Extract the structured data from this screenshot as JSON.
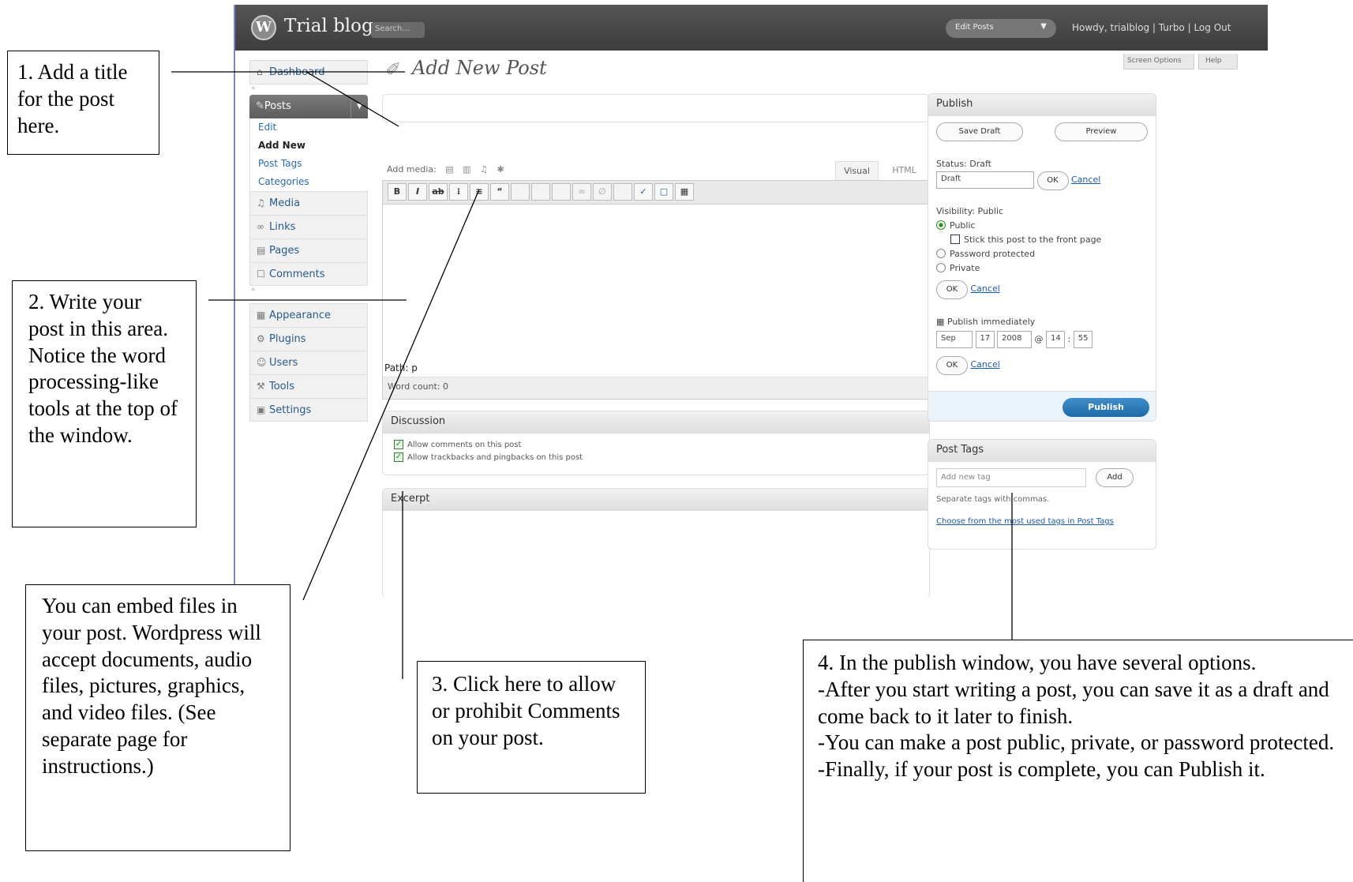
{
  "wp": {
    "blog_name": "Trial blog",
    "search_placeholder": "Search...",
    "edit_posts_dropdown": "Edit Posts",
    "user_links": "Howdy, trialblog | Turbo | Log Out",
    "screen_options": "Screen Options",
    "help": "Help",
    "logo_glyph": "W",
    "sidebar": {
      "dashboard": "Dashboard",
      "posts": "Posts",
      "posts_sub": [
        "Edit",
        "Add New",
        "Post Tags",
        "Categories"
      ],
      "items": [
        "Media",
        "Links",
        "Pages",
        "Comments"
      ],
      "items2": [
        "Appearance",
        "Plugins",
        "Users",
        "Tools",
        "Settings"
      ]
    },
    "page_title": "Add New Post",
    "upload_label": "Add media:",
    "tab_visual": "Visual",
    "tab_html": "HTML",
    "path_label": "Path: p",
    "word_count": "Word count: 0",
    "discussion": {
      "title": "Discussion",
      "allow_comments": "Allow comments on this post",
      "allow_pings": "Allow trackbacks and pingbacks on this post"
    },
    "excerpt_title": "Excerpt",
    "publish": {
      "title": "Publish",
      "save_draft": "Save Draft",
      "preview": "Preview",
      "status": "Status: Draft",
      "status_select": "Draft",
      "ok": "OK",
      "cancel": "Cancel",
      "visibility": "Visibility: Public",
      "vis_public": "Public",
      "sticky": "Stick this post to the front page",
      "vis_password": "Password protected",
      "vis_private": "Private",
      "publish_immediately": "Publish immediately",
      "month": "Sep",
      "day": "17",
      "year": "2008",
      "hour": "14",
      "minute": "55",
      "at": "@",
      "colon": ":",
      "publish_button": "Publish"
    },
    "post_tags": {
      "title": "Post Tags",
      "placeholder": "Add new tag",
      "add": "Add",
      "hint": "Separate tags with commas.",
      "most_used": "Choose from the most used tags in Post Tags"
    }
  },
  "callouts": {
    "c1": "1. Add a title for the post here.",
    "c2": "2. Write your post in this area. Notice the word processing-like tools at the top of the window.",
    "embed": "You can embed files in your post. Wordpress will accept documents, audio files, pictures, graphics, and video files. (See separate page for instructions.)",
    "c3": "3. Click here to allow or prohibit Comments on your post.",
    "c4_lines": [
      "4. In the publish window, you have several options.",
      "-After you start writing a post, you can save it as a draft and come back to it later to finish.",
      "-You can make a post public, private, or password protected.",
      "-Finally, if your post is complete, you can Publish it."
    ]
  }
}
